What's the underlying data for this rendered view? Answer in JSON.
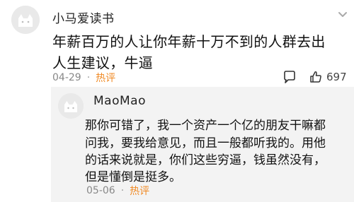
{
  "comment": {
    "username": "小马爱读书",
    "text_line1": "年薪百万的人让你年薪十万不到的人群去出",
    "text_line2": "人生建议，牛逼",
    "date": "04-29",
    "separator": "·",
    "hot_label": "热评",
    "like_count": "697"
  },
  "reply": {
    "username": "MaoMao",
    "text_line1": "那你可错了，我一个资产一个亿的朋友干嘛都",
    "text_line2": "问我，要我给意见，而且一般都听我的。用他",
    "text_line3": "的话来说就是，你们这些穷逼，钱虽然没有，",
    "text_line4": "但是懂倒是挺多。",
    "date": "05-06",
    "separator": "·",
    "hot_label": "热评"
  },
  "colors": {
    "hot": "#f08a24",
    "reply_bg": "#f3f3f3",
    "meta": "#888888"
  },
  "icons": [
    "avatar-placeholder",
    "more-icon",
    "comment-icon",
    "like-icon"
  ]
}
